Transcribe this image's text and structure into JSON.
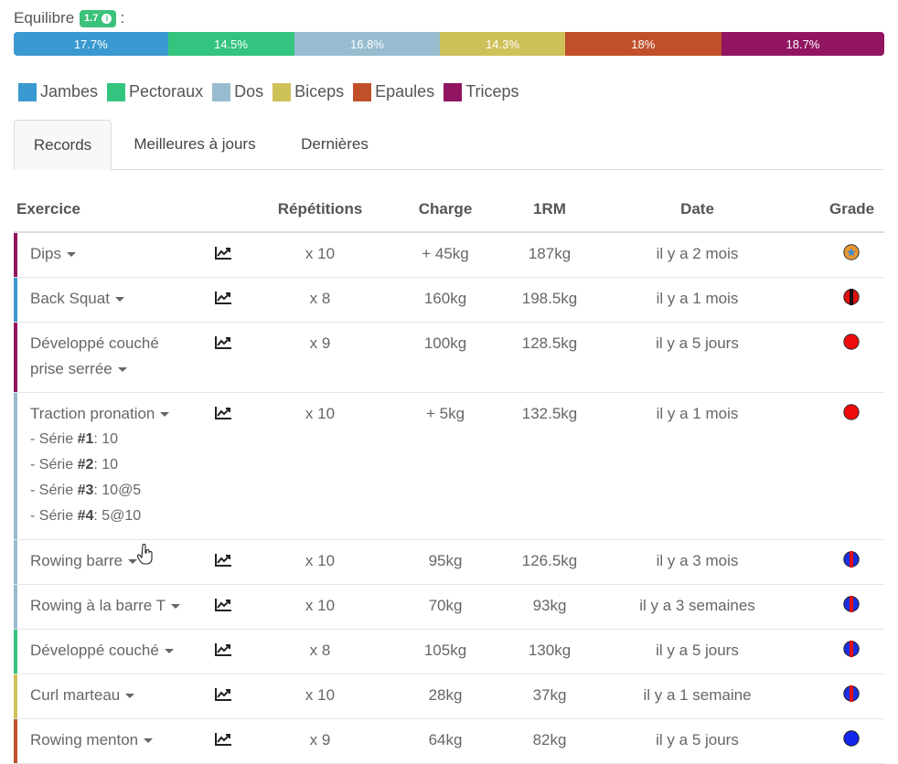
{
  "balance": {
    "label": "Equilibre",
    "score": "1.7",
    "colon": ":",
    "segments": [
      {
        "muscle": "Jambes",
        "percent": "17.7%",
        "value": 17.7,
        "color": "#3a99d0"
      },
      {
        "muscle": "Pectoraux",
        "percent": "14.5%",
        "value": 14.5,
        "color": "#33c47f"
      },
      {
        "muscle": "Dos",
        "percent": "16.8%",
        "value": 16.8,
        "color": "#97bcd0"
      },
      {
        "muscle": "Biceps",
        "percent": "14.3%",
        "value": 14.3,
        "color": "#cfc15a"
      },
      {
        "muscle": "Epaules",
        "percent": "18%",
        "value": 18.0,
        "color": "#c1502a"
      },
      {
        "muscle": "Triceps",
        "percent": "18.7%",
        "value": 18.7,
        "color": "#921561"
      }
    ]
  },
  "tabs": [
    {
      "label": "Records",
      "active": true
    },
    {
      "label": "Meilleures à jours",
      "active": false
    },
    {
      "label": "Dernières",
      "active": false
    }
  ],
  "table": {
    "headers": {
      "exercise": "Exercice",
      "reps": "Répétitions",
      "charge": "Charge",
      "rm": "1RM",
      "date": "Date",
      "grade": "Grade"
    },
    "rows": [
      {
        "name": "Dips",
        "reps": "x 10",
        "charge": "+ 45kg",
        "rm": "187kg",
        "date": "il y a 2 mois",
        "accent": "#921561",
        "grade": "orange-star"
      },
      {
        "name": "Back Squat",
        "reps": "x 8",
        "charge": "160kg",
        "rm": "198.5kg",
        "date": "il y a 1 mois",
        "accent": "#3a99d0",
        "grade": "red-black"
      },
      {
        "name_lines": [
          "Développé couché",
          "prise serrée"
        ],
        "reps": "x 9",
        "charge": "100kg",
        "rm": "128.5kg",
        "date": "il y a 5 jours",
        "accent": "#921561",
        "grade": "red"
      },
      {
        "name": "Traction pronation",
        "series": [
          {
            "prefix": "- Série ",
            "num": "#1",
            "value": ": 10"
          },
          {
            "prefix": "- Série ",
            "num": "#2",
            "value": ": 10"
          },
          {
            "prefix": "- Série ",
            "num": "#3",
            "value": ": 10@5"
          },
          {
            "prefix": "- Série ",
            "num": "#4",
            "value": ": 5@10"
          }
        ],
        "reps": "x 10",
        "charge": "+ 5kg",
        "rm": "132.5kg",
        "date": "il y a 1 mois",
        "accent": "#97bcd0",
        "grade": "red"
      },
      {
        "name": "Rowing barre",
        "reps": "x 10",
        "charge": "95kg",
        "rm": "126.5kg",
        "date": "il y a 3 mois",
        "accent": "#97bcd0",
        "grade": "blue-red"
      },
      {
        "name": "Rowing à la barre T",
        "reps": "x 10",
        "charge": "70kg",
        "rm": "93kg",
        "date": "il y a 3 semaines",
        "accent": "#97bcd0",
        "grade": "blue-red"
      },
      {
        "name": "Développé couché",
        "reps": "x 8",
        "charge": "105kg",
        "rm": "130kg",
        "date": "il y a 5 jours",
        "accent": "#33c47f",
        "grade": "blue-red"
      },
      {
        "name": "Curl marteau",
        "reps": "x 10",
        "charge": "28kg",
        "rm": "37kg",
        "date": "il y a 1 semaine",
        "accent": "#cfc15a",
        "grade": "blue-red"
      },
      {
        "name": "Rowing menton",
        "reps": "x 9",
        "charge": "64kg",
        "rm": "82kg",
        "date": "il y a 5 jours",
        "accent": "#c1502a",
        "grade": "blue"
      }
    ]
  }
}
